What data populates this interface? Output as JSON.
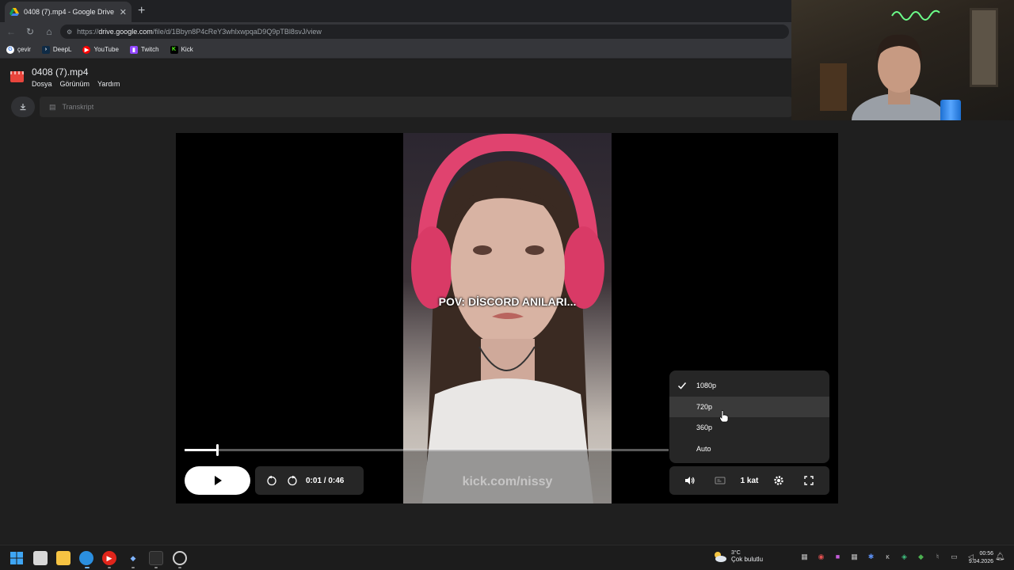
{
  "browser": {
    "tab_title": "0408 (7).mp4 - Google Drive",
    "new_tab_label": "+",
    "url_prefix": "https://",
    "url_host": "drive.google.com",
    "url_path": "/file/d/1Bbyn8P4cReY3whlxwpqaD9Q9pTBl8svJ/view"
  },
  "bookmarks": [
    {
      "label": "çevir",
      "icon": "google-icon",
      "color": "#4285f4"
    },
    {
      "label": "DeepL",
      "icon": "deepl-icon",
      "color": "#0f2b46"
    },
    {
      "label": "YouTube",
      "icon": "youtube-icon",
      "color": "#ff0000"
    },
    {
      "label": "Twitch",
      "icon": "twitch-icon",
      "color": "#9146ff"
    },
    {
      "label": "Kick",
      "icon": "kick-icon",
      "color": "#53fc18"
    }
  ],
  "drive": {
    "file_name": "0408 (7).mp4",
    "menus": [
      "Dosya",
      "Görünüm",
      "Yardım"
    ],
    "transcript_label": "Transkript"
  },
  "video": {
    "caption": "POV: DİSCORD ANILARI...",
    "watermark": "kick.com/nissy",
    "current_time": "0:01",
    "duration": "0:46",
    "time_display": "0:01 / 0:46",
    "progress_fraction": 0.065,
    "speed_label": "1 kat"
  },
  "quality_menu": {
    "selected": "1080p",
    "hovered": "720p",
    "options": [
      "1080p",
      "720p",
      "360p",
      "Auto"
    ]
  },
  "taskbar": {
    "weather_temp": "3°C",
    "weather_desc": "Çok bulutlu",
    "time": "00:56",
    "date": "9.04.2026"
  },
  "colors": {
    "drive_red": "#e8453c",
    "chrome_dark": "#202124",
    "menu_bg": "#262626"
  }
}
